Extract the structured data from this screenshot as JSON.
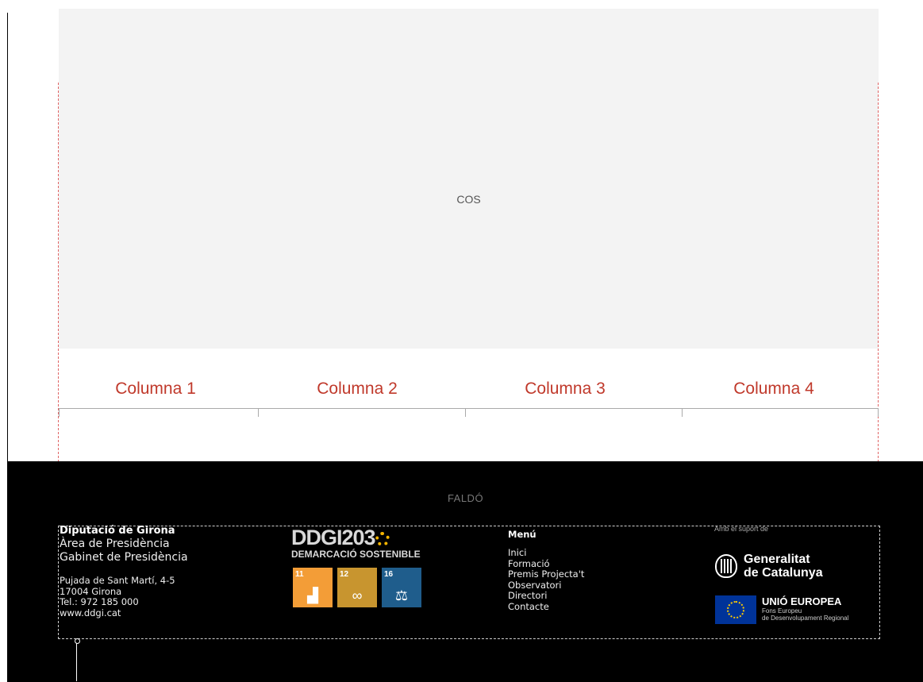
{
  "cos": {
    "label": "COS"
  },
  "columns": [
    "Columna 1",
    "Columna 2",
    "Columna 3",
    "Columna 4"
  ],
  "footer": {
    "label": "FALDÓ",
    "org": {
      "name": "Diputació de Girona",
      "lines": [
        "Àrea de Presidència",
        "Gabinet de Presidència"
      ],
      "address": [
        "Pujada de Sant Martí, 4-5",
        "17004 Girona",
        "Tel.: 972 185 000",
        "www.ddgi.cat"
      ]
    },
    "ddgi": {
      "title": "DDGI203",
      "subtitle": "DEMARCACIÓ SOSTENIBLE",
      "sdgs": [
        {
          "number": "11",
          "color": "#f39d37",
          "glyph": "▟"
        },
        {
          "number": "12",
          "color": "#c8952f",
          "glyph": "∞"
        },
        {
          "number": "16",
          "color": "#1f5d8c",
          "glyph": "⚖"
        }
      ]
    },
    "menu": {
      "title": "Menú",
      "items": [
        "Inici",
        "Formació",
        "Premis Projecta't",
        "Observatori",
        "Directori",
        "Contacte"
      ]
    },
    "support": {
      "label": "Amb el suport de",
      "gencat": [
        "Generalitat",
        "de Catalunya"
      ],
      "eu": {
        "title": "UNIÓ EUROPEA",
        "sub1": "Fons Europeu",
        "sub2": "de Desenvolupament Regional"
      }
    }
  }
}
